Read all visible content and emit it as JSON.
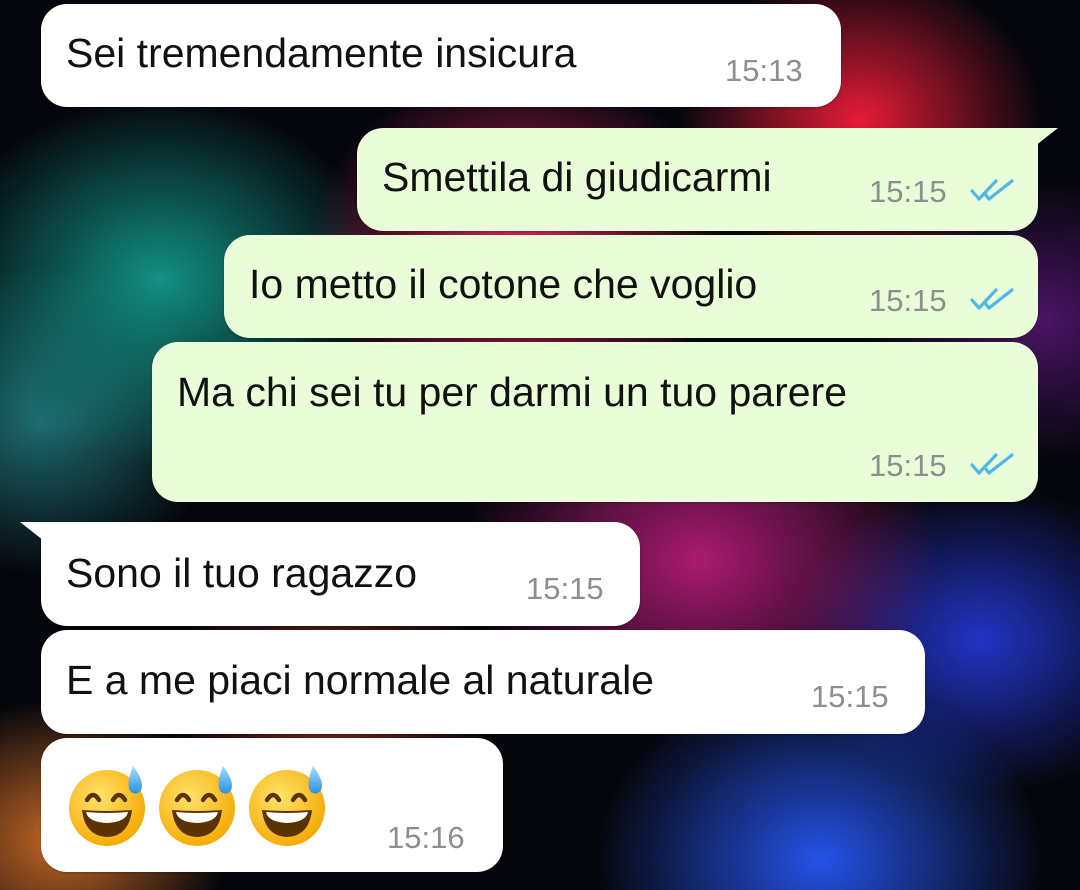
{
  "messages": [
    {
      "text": "Sei tremendamente insicura",
      "time": "15:13",
      "direction": "incoming"
    },
    {
      "text": "Smettila di giudicarmi",
      "time": "15:15",
      "direction": "outgoing",
      "read": true
    },
    {
      "text": "Io metto il cotone che voglio",
      "time": "15:15",
      "direction": "outgoing",
      "read": true
    },
    {
      "text": "Ma chi sei tu per darmi un tuo parere",
      "time": "15:15",
      "direction": "outgoing",
      "read": true
    },
    {
      "text": "Sono il tuo ragazzo",
      "time": "15:15",
      "direction": "incoming"
    },
    {
      "text": "E a me piaci normale al naturale",
      "time": "15:15",
      "direction": "incoming"
    },
    {
      "text": "😅😅😅",
      "time": "15:16",
      "direction": "incoming",
      "emoji": "grinning-face-with-sweat"
    }
  ],
  "colors": {
    "incoming_bubble": "#ffffff",
    "outgoing_bubble": "#e8fdd8",
    "read_ticks": "#4fb6ec",
    "timestamp": "#8b8f8d"
  },
  "icons": {
    "read_receipt": "double-check-icon",
    "emoji": "grinning-face-with-sweat-emoji"
  }
}
